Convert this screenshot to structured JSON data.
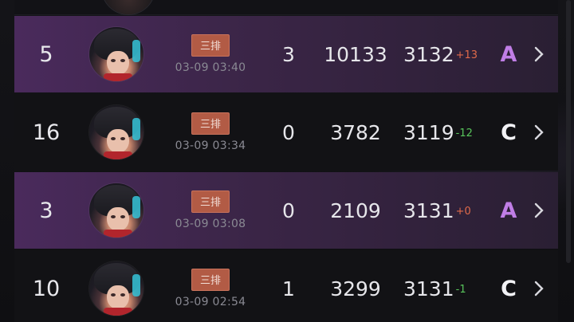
{
  "matches": [
    {
      "rank": "5",
      "mode": "三排",
      "time": "03-09 03:40",
      "kills": "3",
      "score": "10133",
      "rating": "3132",
      "delta": "+13",
      "delta_dir": "up",
      "grade": "A",
      "highlight": true
    },
    {
      "rank": "16",
      "mode": "三排",
      "time": "03-09 03:34",
      "kills": "0",
      "score": "3782",
      "rating": "3119",
      "delta": "-12",
      "delta_dir": "down",
      "grade": "C",
      "highlight": false
    },
    {
      "rank": "3",
      "mode": "三排",
      "time": "03-09 03:08",
      "kills": "0",
      "score": "2109",
      "rating": "3131",
      "delta": "+0",
      "delta_dir": "up",
      "grade": "A",
      "highlight": true
    },
    {
      "rank": "10",
      "mode": "三排",
      "time": "03-09 02:54",
      "kills": "1",
      "score": "3299",
      "rating": "3131",
      "delta": "-1",
      "delta_dir": "down",
      "grade": "C",
      "highlight": false
    }
  ],
  "icons": {
    "arrow": "chevron-right-icon",
    "avatar": "player-avatar"
  },
  "colors": {
    "highlight_row": "#4a2a5c",
    "normal_row": "#121215",
    "tag_bg": "#b25b45",
    "delta_up": "#e06a4a",
    "delta_down": "#58c55b",
    "grade_a": "#c07ee6",
    "grade_c": "#f2f2f5"
  }
}
